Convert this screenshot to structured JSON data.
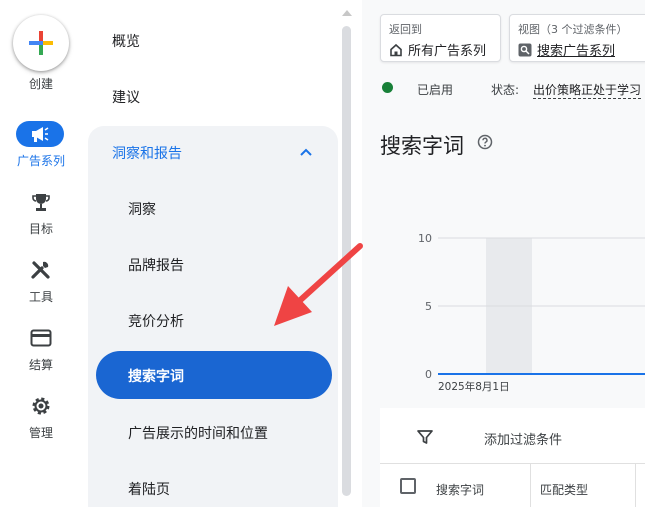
{
  "rail": {
    "create_label": "创建",
    "items": [
      {
        "label": "广告系列",
        "icon": "megaphone-icon"
      },
      {
        "label": "目标",
        "icon": "trophy-icon"
      },
      {
        "label": "工具",
        "icon": "tools-icon"
      },
      {
        "label": "结算",
        "icon": "credit-card-icon"
      },
      {
        "label": "管理",
        "icon": "gear-icon"
      }
    ]
  },
  "nav": {
    "top_items": [
      "概览",
      "建议"
    ],
    "group_title": "洞察和报告",
    "sub_items": [
      "洞察",
      "品牌报告",
      "竞价分析",
      "搜索字词",
      "广告展示的时间和位置",
      "着陆页"
    ],
    "active_item": "搜索字词"
  },
  "header": {
    "back_small": "返回到",
    "back_main": "所有广告系列",
    "view_small": "视图（3 个过滤条件）",
    "view_main": "搜索广告系列"
  },
  "status": {
    "enabled": "已启用",
    "state_label": "状态:",
    "state_value": "出价策略正处于学习"
  },
  "page": {
    "title": "搜索字词"
  },
  "chart_data": {
    "type": "line",
    "x": [
      "2025年8月1日"
    ],
    "series": [
      {
        "values": [
          0
        ]
      }
    ],
    "yticks": [
      10,
      5,
      0
    ],
    "ylim": [
      0,
      10
    ],
    "grid": true
  },
  "filter": {
    "add_label": "添加过滤条件"
  },
  "table": {
    "columns": [
      "搜索字词",
      "匹配类型"
    ]
  },
  "colors": {
    "accent": "#1a73e8",
    "active_pill": "#1a66d2",
    "status_green": "#188038",
    "annotation_arrow": "#ef4444"
  }
}
